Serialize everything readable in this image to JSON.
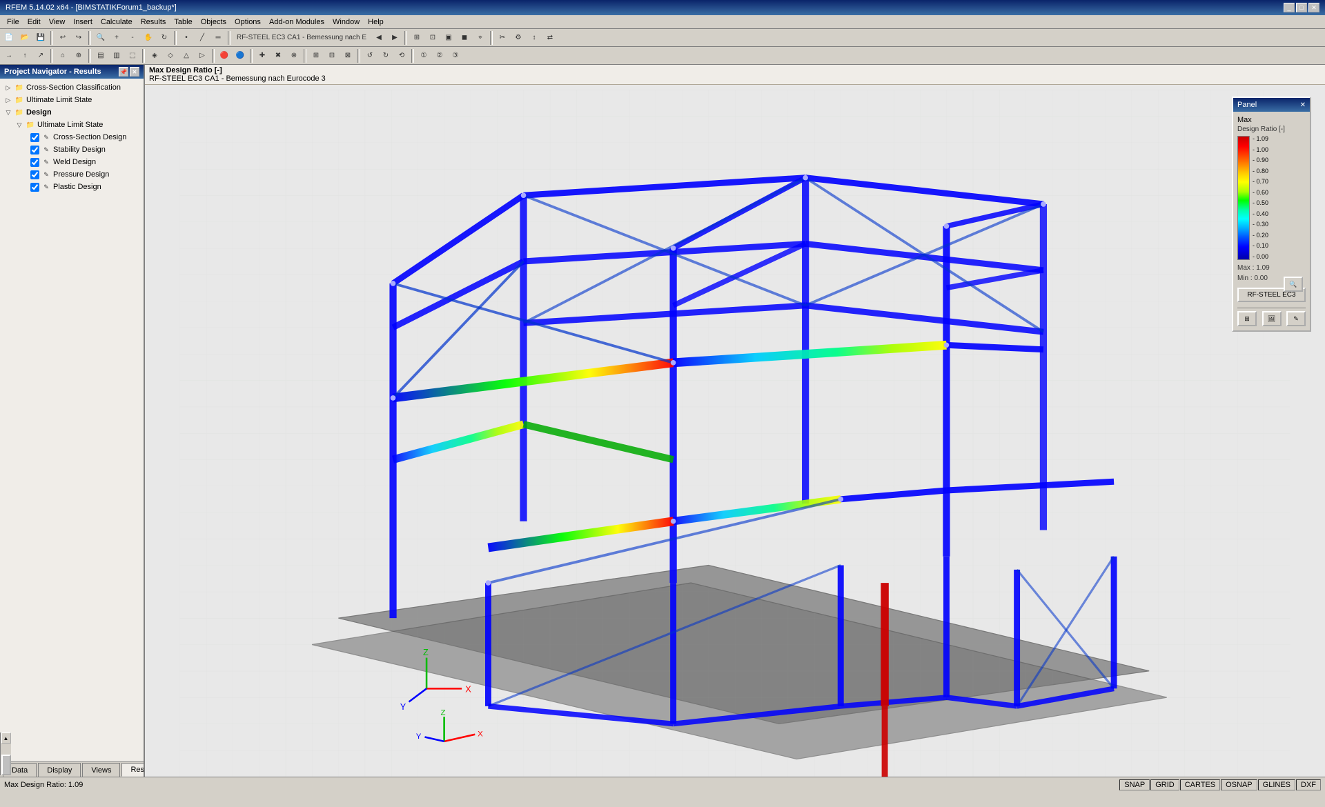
{
  "titlebar": {
    "title": "RFEM 5.14.02 x64 - [BIMSTATIKForum1_backup*]",
    "controls": [
      "_",
      "□",
      "✕"
    ]
  },
  "menubar": {
    "items": [
      "File",
      "Edit",
      "View",
      "Insert",
      "Calculate",
      "Results",
      "Table",
      "Objects",
      "Options",
      "Add-on Modules",
      "Window",
      "Help"
    ]
  },
  "left_panel": {
    "header": "Project Navigator - Results",
    "tree": [
      {
        "id": "cross-section-class",
        "label": "Cross-Section Classification",
        "level": 1,
        "indent": 20,
        "has_checkbox": false,
        "expand": false
      },
      {
        "id": "ultimate-limit-state-1",
        "label": "Ultimate Limit State",
        "level": 1,
        "indent": 20,
        "has_checkbox": false,
        "expand": false
      },
      {
        "id": "design",
        "label": "Design",
        "level": 0,
        "indent": 8,
        "has_checkbox": false,
        "expand": true,
        "bold": true
      },
      {
        "id": "ultimate-limit-state-2",
        "label": "Ultimate Limit State",
        "level": 1,
        "indent": 20,
        "has_checkbox": false,
        "expand": true
      },
      {
        "id": "cross-section-design",
        "label": "Cross-Section Design",
        "level": 2,
        "indent": 36,
        "has_checkbox": true,
        "checked": true
      },
      {
        "id": "stability-design",
        "label": "Stability Design",
        "level": 2,
        "indent": 36,
        "has_checkbox": true,
        "checked": true
      },
      {
        "id": "weld-design",
        "label": "Weld Design",
        "level": 2,
        "indent": 36,
        "has_checkbox": true,
        "checked": true
      },
      {
        "id": "pressure-design",
        "label": "Pressure Design",
        "level": 2,
        "indent": 36,
        "has_checkbox": true,
        "checked": true
      },
      {
        "id": "plastic-design",
        "label": "Plastic Design",
        "level": 2,
        "indent": 36,
        "has_checkbox": true,
        "checked": true
      }
    ]
  },
  "viewport": {
    "info_line1": "Max Design Ratio [-]",
    "info_line2": "RF-STEEL EC3 CA1 - Bemessung nach Eurocode 3"
  },
  "status_bar": {
    "max_ratio": "Max Design Ratio: 1.09",
    "items": [
      "SNAP",
      "GRID",
      "CARTES",
      "OSNAP",
      "GLINES",
      "DXF"
    ]
  },
  "bottom_tabs": [
    {
      "label": "Data",
      "active": false
    },
    {
      "label": "Display",
      "active": false
    },
    {
      "label": "Views",
      "active": false
    },
    {
      "label": "Results",
      "active": true
    }
  ],
  "panel": {
    "header": "Panel",
    "label_max": "Max",
    "label_ratio": "Design Ratio [-]",
    "color_values": [
      "1.09",
      "1.00",
      "0.90",
      "0.80",
      "0.70",
      "0.60",
      "0.50",
      "0.40",
      "0.30",
      "0.20",
      "0.10",
      "0.00"
    ],
    "max_value": "1.09",
    "min_value": "0.00",
    "max_label": "Max :",
    "min_label": "Min :",
    "button_label": "RF-STEEL EC3",
    "close_btn": "✕"
  }
}
